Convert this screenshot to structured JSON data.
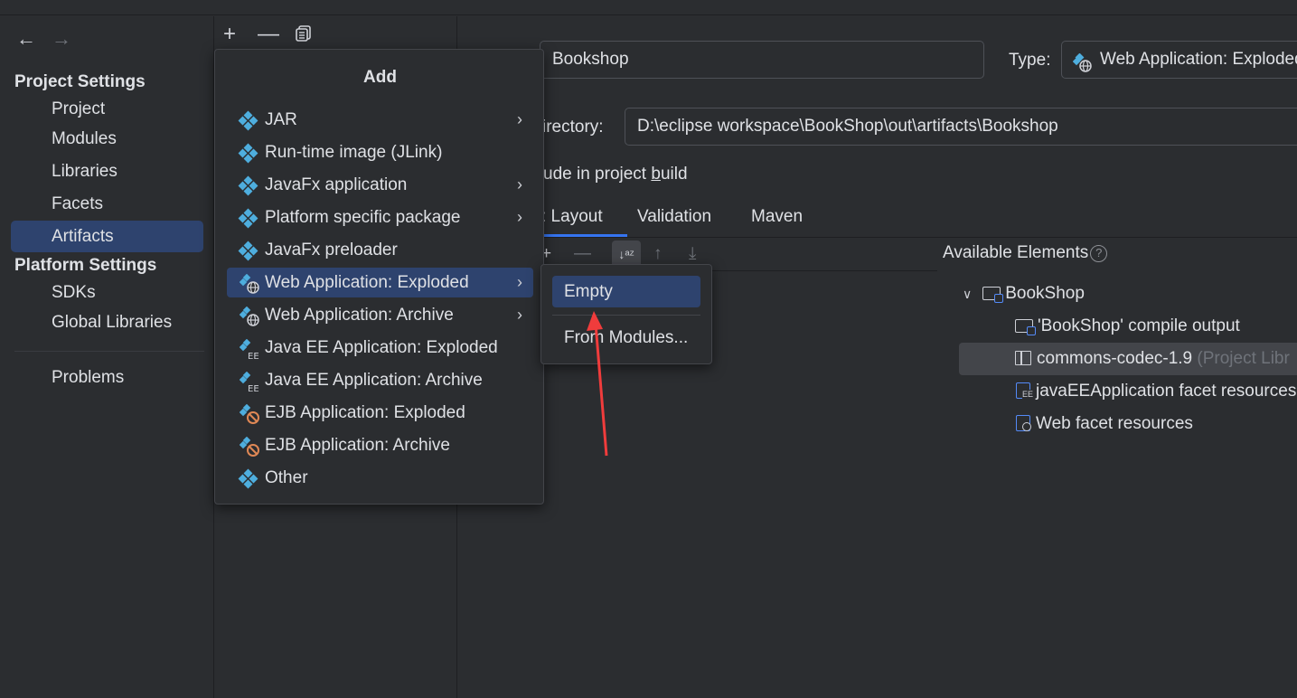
{
  "navigation": {
    "back_icon": "arrow-left-icon",
    "forward_icon": "arrow-right-icon"
  },
  "sidebar": {
    "project_settings_title": "Project Settings",
    "project_items": [
      "Project",
      "Modules",
      "Libraries",
      "Facets",
      "Artifacts"
    ],
    "platform_settings_title": "Platform Settings",
    "platform_items": [
      "SDKs",
      "Global Libraries"
    ],
    "problems_label": "Problems",
    "selected": "Artifacts"
  },
  "middle_toolbar": {
    "add_icon": "plus-icon",
    "remove_icon": "minus-icon",
    "copy_icon": "copy-icon"
  },
  "artifact": {
    "name_value": "Bookshop",
    "type_label": "Type:",
    "type_value": "Web Application: Exploded",
    "output_dir_label": "irectory:",
    "output_dir_value": "D:\\eclipse workspace\\BookShop\\out\\artifacts\\Bookshop",
    "include_build_label_pre": "ude in project ",
    "include_build_label_mnemonic": "b",
    "include_build_label_post": "uild"
  },
  "tabs": [
    {
      "label": ": Layout"
    },
    {
      "label": "Validation"
    },
    {
      "label": "Maven"
    }
  ],
  "available": {
    "title": "Available Elements",
    "help_icon": "?",
    "tree": {
      "root": "BookShop",
      "children": [
        {
          "label": "'BookShop' compile output",
          "suffix": ""
        },
        {
          "label": "commons-codec-1.9",
          "suffix": " (Project Libr"
        },
        {
          "label": "javaEEApplication facet resources",
          "suffix": ""
        },
        {
          "label": "Web facet resources",
          "suffix": ""
        }
      ]
    }
  },
  "add_popup": {
    "title": "Add",
    "items": [
      {
        "label": "JAR",
        "submenu": true
      },
      {
        "label": "Run-time image (JLink)",
        "submenu": false
      },
      {
        "label": "JavaFx application",
        "submenu": true
      },
      {
        "label": "Platform specific package",
        "submenu": true
      },
      {
        "label": "JavaFx preloader",
        "submenu": false
      },
      {
        "label": "Web Application: Exploded",
        "submenu": true
      },
      {
        "label": "Web Application: Archive",
        "submenu": true
      },
      {
        "label": "Java EE Application: Exploded",
        "submenu": false
      },
      {
        "label": "Java EE Application: Archive",
        "submenu": false
      },
      {
        "label": "EJB Application: Exploded",
        "submenu": false
      },
      {
        "label": "EJB Application: Archive",
        "submenu": false
      },
      {
        "label": "Other",
        "submenu": false
      }
    ],
    "active": "Web Application: Exploded"
  },
  "submenu": {
    "items": [
      "Empty",
      "From Modules..."
    ],
    "active": "Empty"
  },
  "colors": {
    "selection": "#2e436e",
    "accent": "#3574f0",
    "annotation_arrow": "#f03c3c"
  }
}
